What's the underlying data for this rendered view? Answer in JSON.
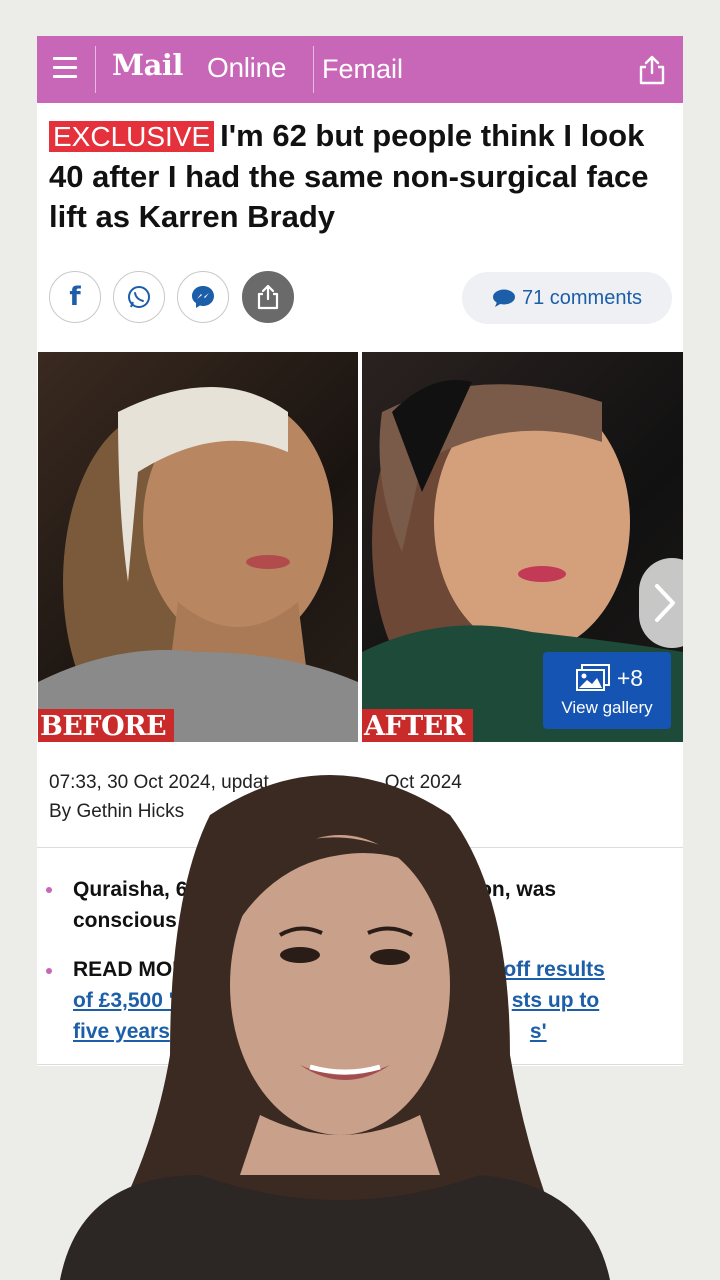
{
  "header": {
    "brand_bold": "Mail",
    "brand_light": "Online",
    "section": "Femail"
  },
  "article": {
    "badge": "EXCLUSIVE",
    "headline": "I'm 62 but people think I look 40 after I had the same non-surgical face lift as Karren Brady",
    "comments": "71 comments",
    "photo_before_label": "BEFORE",
    "photo_after_label": "AFTER",
    "gallery_count": "+8",
    "gallery_label": "View gallery",
    "timestamp": "07:33, 30 Oct 2024, updat",
    "timestamp_end": "Oct 2024",
    "byline": "By Gethin Hicks",
    "bullet1_a": "Quraisha, 62",
    "bullet1_b": "on, was",
    "bullet1_c": "conscious o",
    "bullet2_a": "READ MORE",
    "bullet2_link_a": "off results",
    "bullet2_link_b": "of £3,500 '",
    "bullet2_link_c": "sts up to",
    "bullet2_link_d": "five years",
    "bullet2_link_e": "s'"
  },
  "icons": [
    "menu-icon",
    "share-icon",
    "facebook-icon",
    "whatsapp-icon",
    "messenger-icon",
    "comment-icon",
    "gallery-icon",
    "chevron-right-icon"
  ],
  "colors": {
    "brand": "#c866b7",
    "badge": "#e4313c",
    "link": "#1c5fa8",
    "gallery": "#1554b3",
    "tag": "#c92a2a"
  }
}
